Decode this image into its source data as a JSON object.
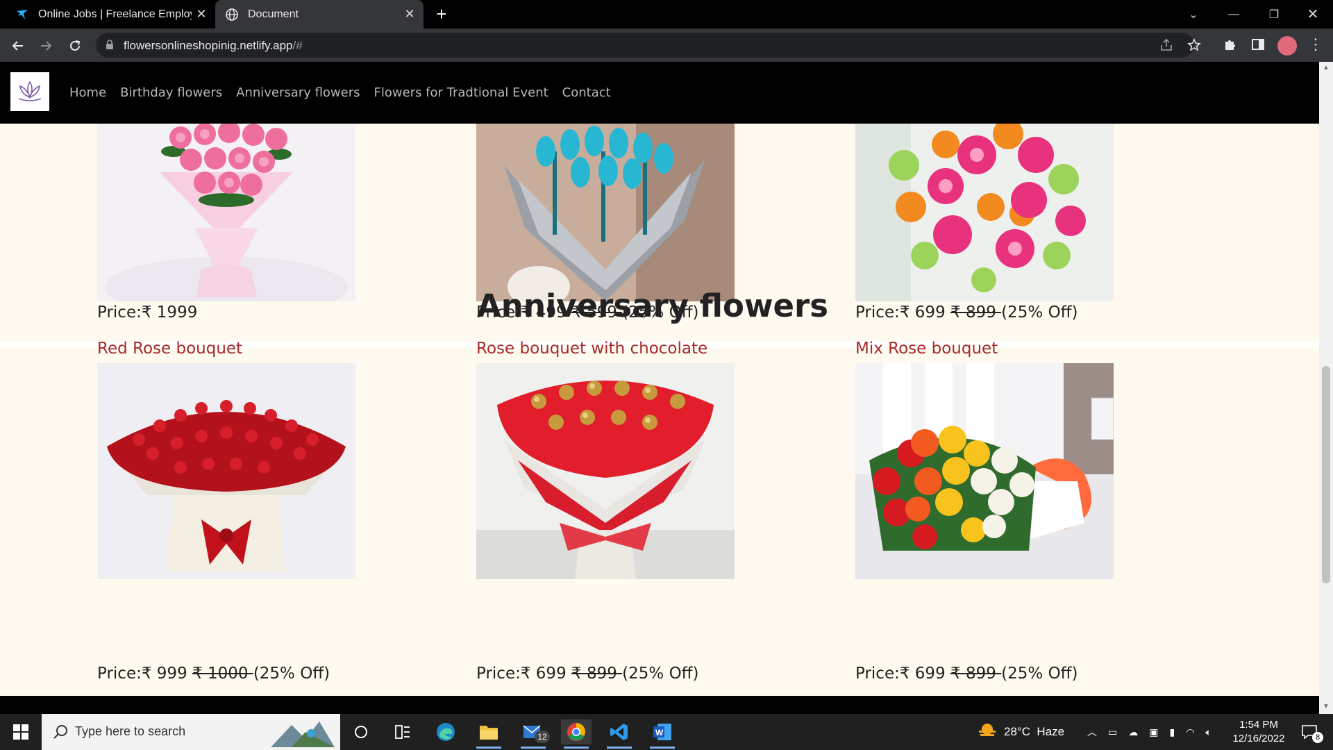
{
  "browser": {
    "tabs": [
      {
        "title": "Online Jobs | Freelance Employm",
        "active": false,
        "icon": "freelancer-bird-icon"
      },
      {
        "title": "Document",
        "active": true,
        "icon": "globe-icon"
      }
    ],
    "url_host": "flowersonlineshopinig.netlify.app",
    "url_rest": "/#"
  },
  "site": {
    "nav": [
      "Home",
      "Birthday flowers",
      "Anniversary flowers",
      "Flowers for Tradtional Event",
      "Contact"
    ],
    "top_cards": [
      {
        "price_label": "Price:₹ 1999",
        "old_price": "",
        "discount": ""
      },
      {
        "price_label": "Price:₹ 499",
        "old_price": "₹ 599 ",
        "discount": "(25% Off)"
      },
      {
        "price_label": "Price:₹ 699",
        "old_price": "₹ 899 ",
        "discount": "(25% Off)"
      }
    ],
    "anniversary": {
      "heading": "Anniversary flowers",
      "cards": [
        {
          "name": "Red Rose bouquet",
          "price_label": "Price:₹ 999",
          "old_price": "₹ 1000 ",
          "discount": "(25% Off)"
        },
        {
          "name": "Rose bouquet with chocolate",
          "price_label": "Price:₹ 699",
          "old_price": "₹ 899 ",
          "discount": "(25% Off)"
        },
        {
          "name": "Mix Rose bouquet",
          "price_label": "Price:₹ 699",
          "old_price": "₹ 899 ",
          "discount": "(25% Off)"
        }
      ]
    }
  },
  "taskbar": {
    "search_placeholder": "Type here to search",
    "weather": "28°C  Haze",
    "time": "1:54 PM",
    "date": "12/16/2022",
    "mail_badge": "12",
    "notification_badge": "8"
  },
  "colors": {
    "page_bg": "#fefaef",
    "product_name": "#a52a2a",
    "nav_bg": "#000000"
  }
}
